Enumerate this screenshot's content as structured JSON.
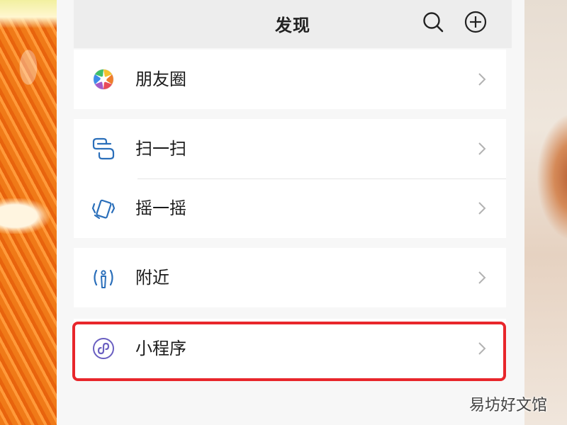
{
  "header": {
    "title": "发现",
    "search_icon": "search-icon",
    "add_icon": "add-circle-icon"
  },
  "menu": {
    "moments": {
      "label": "朋友圈",
      "icon": "aperture-icon"
    },
    "scan": {
      "label": "扫一扫",
      "icon": "scan-icon"
    },
    "shake": {
      "label": "摇一摇",
      "icon": "shake-icon"
    },
    "nearby": {
      "label": "附近",
      "icon": "nearby-icon"
    },
    "mini_programs": {
      "label": "小程序",
      "icon": "mini-program-icon"
    }
  },
  "watermark": "易坊好文馆",
  "colors": {
    "highlight": "#e8262b",
    "icon_blue": "#2b6fba",
    "mini_program_purple": "#6a5fc1",
    "panel_bg": "#f7f7f7"
  }
}
